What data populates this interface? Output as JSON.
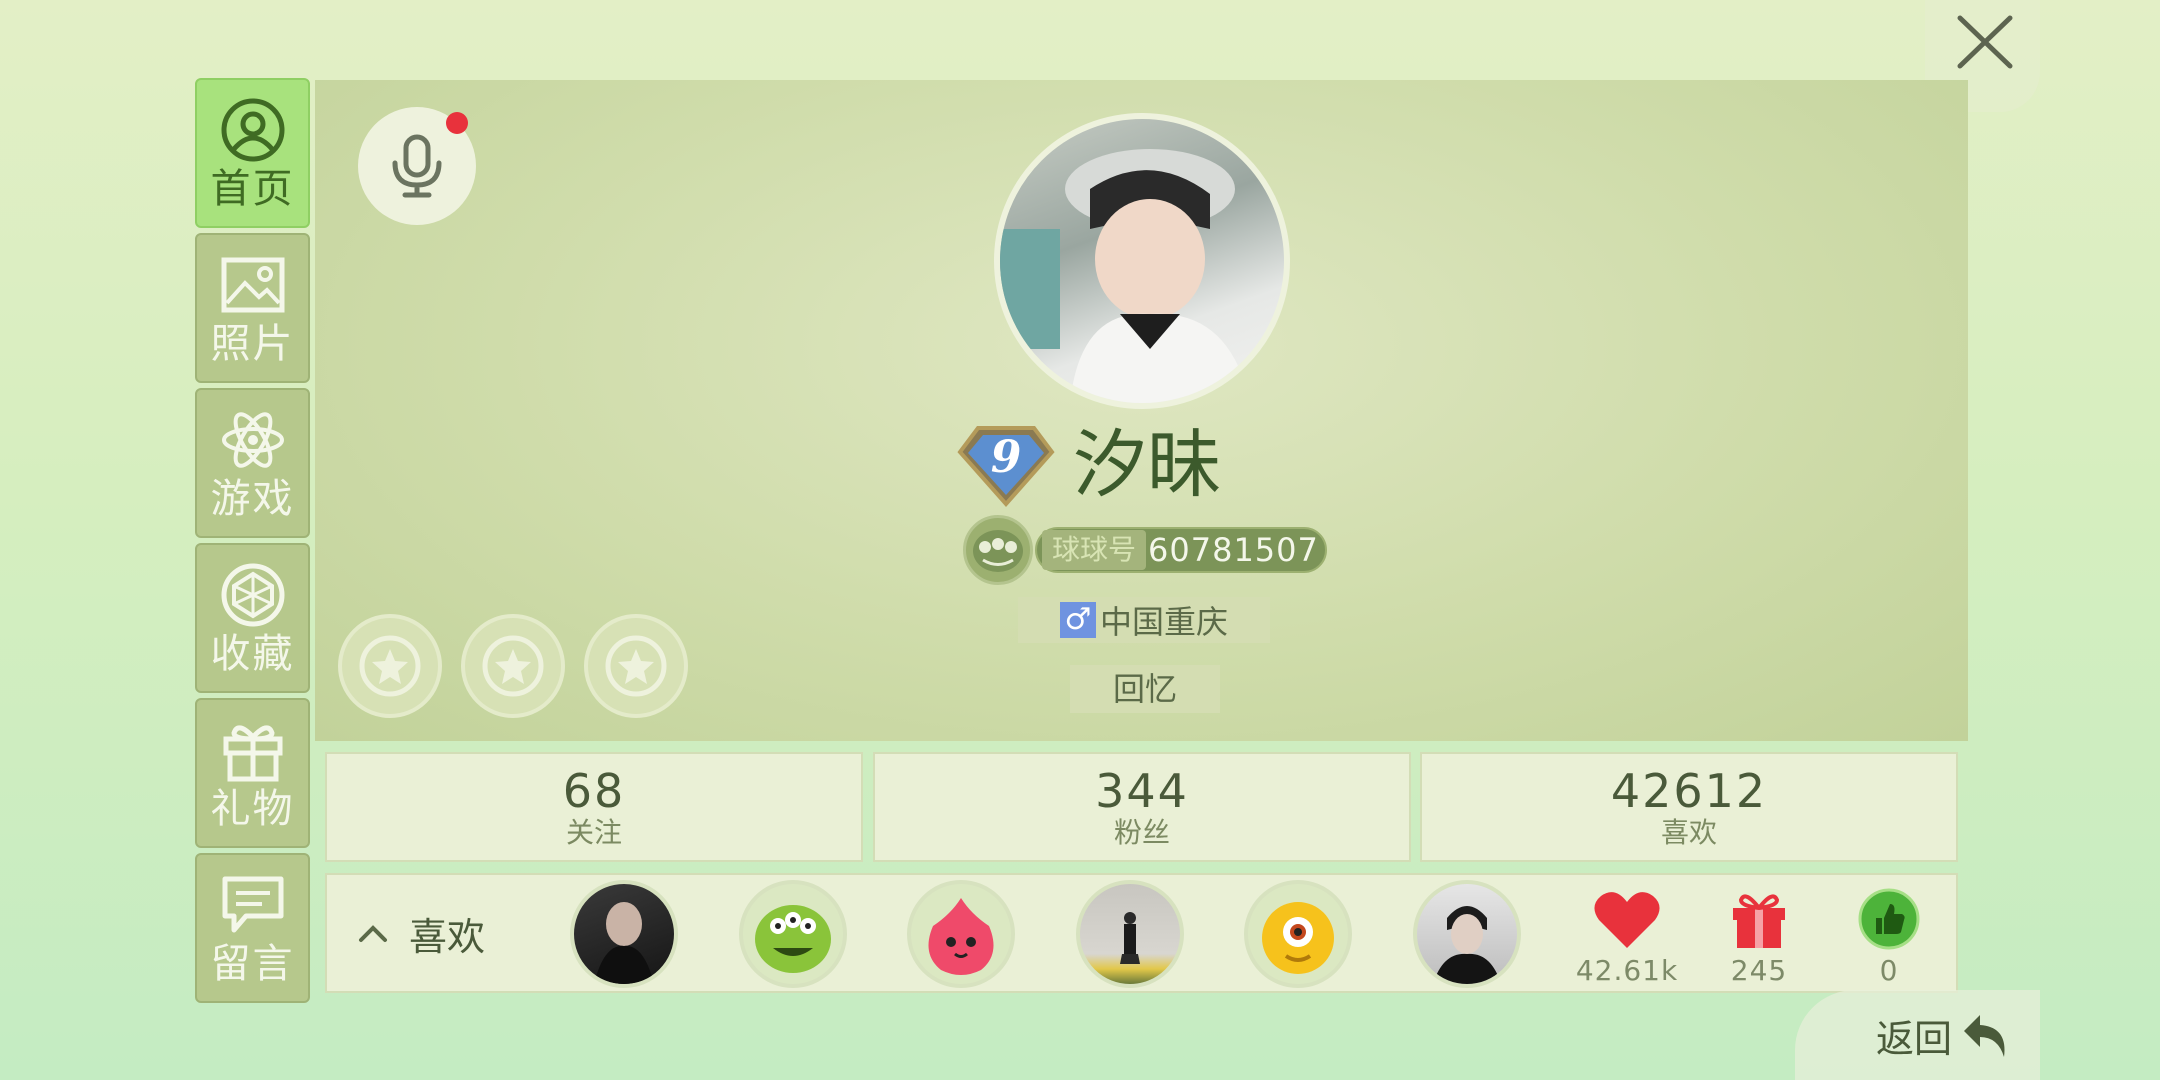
{
  "sidebar": {
    "items": [
      {
        "label": "首页",
        "icon": "profile-icon",
        "active": true
      },
      {
        "label": "照片",
        "icon": "image-icon",
        "active": false
      },
      {
        "label": "游戏",
        "icon": "atom-icon",
        "active": false
      },
      {
        "label": "收藏",
        "icon": "collection-icon",
        "active": false
      },
      {
        "label": "礼物",
        "icon": "gift-icon",
        "active": false
      },
      {
        "label": "留言",
        "icon": "message-icon",
        "active": false
      }
    ]
  },
  "profile": {
    "level": "9",
    "name": "汐昧",
    "id_label": "球球号",
    "id": "60781507",
    "gender_symbol": "♂",
    "location": "中国重庆",
    "signature": "回忆"
  },
  "stats": [
    {
      "value": "68",
      "label": "关注"
    },
    {
      "value": "344",
      "label": "粉丝"
    },
    {
      "value": "42612",
      "label": "喜欢"
    }
  ],
  "likes": {
    "label": "喜欢",
    "toggle_icon": "chevron-up-icon",
    "counters": [
      {
        "icon": "heart-icon",
        "value": "42.61k"
      },
      {
        "icon": "gift-icon",
        "value": "245"
      },
      {
        "icon": "thumbs-up-icon",
        "value": "0"
      }
    ]
  },
  "footer": {
    "back_label": "返回"
  },
  "colors": {
    "accent_green": "#a8e27d",
    "sidebar_green": "#b6c88c",
    "notification_red": "#e8323c"
  }
}
